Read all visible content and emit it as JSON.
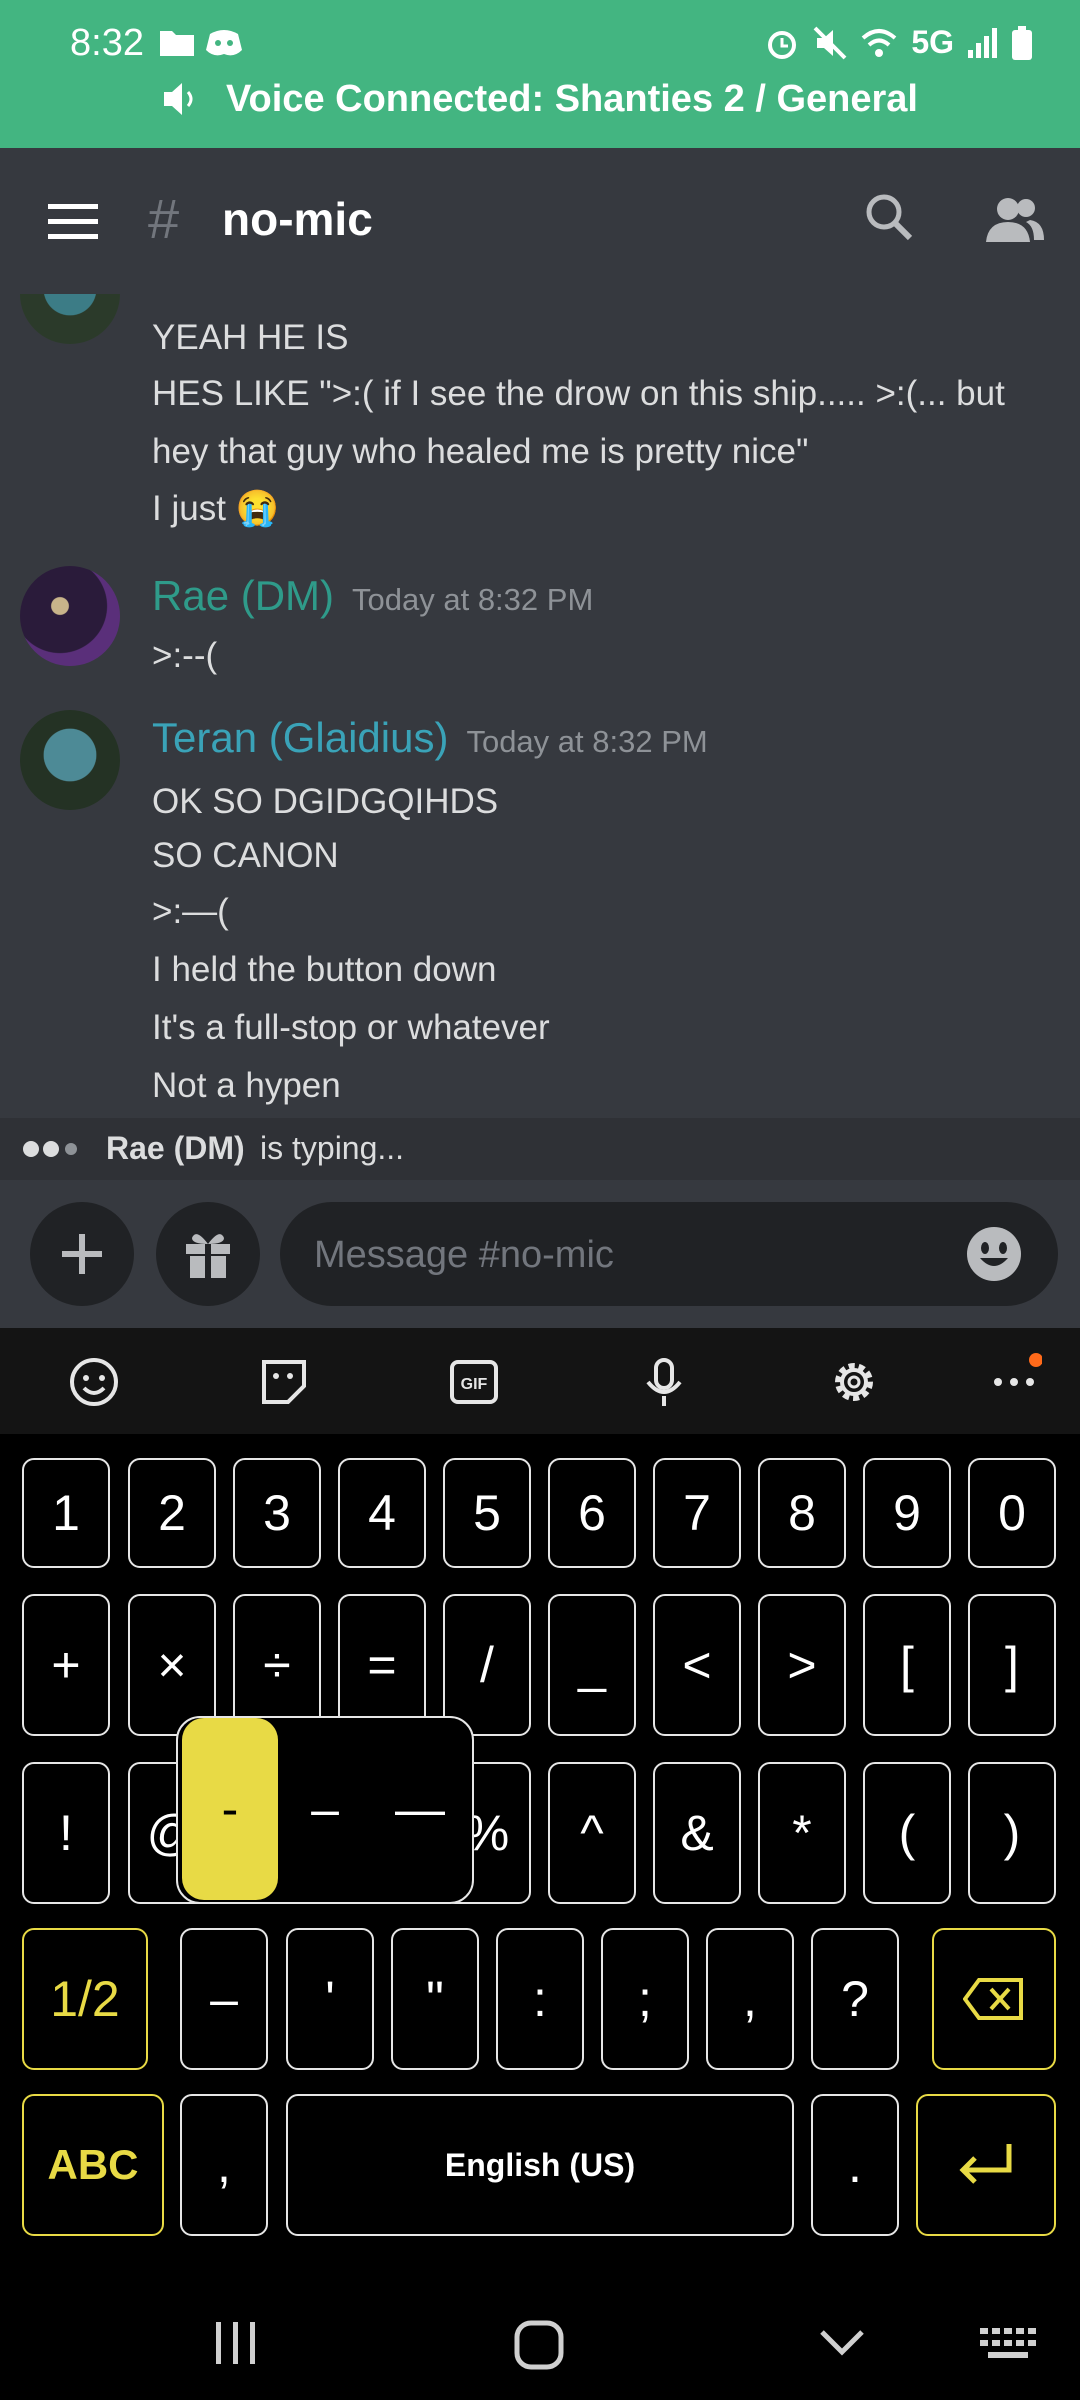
{
  "status_bar": {
    "time": "8:32",
    "network": "5G"
  },
  "voice_banner": {
    "text": "Voice Connected: Shanties 2 / General"
  },
  "header": {
    "hash": "#",
    "channel": "no-mic"
  },
  "messages": [
    {
      "lines": [
        "YEAH HE IS",
        "HES LIKE \">:( if I see the drow on this ship..... >:(... but",
        "hey that guy who healed me is pretty nice\"",
        "I just 😭"
      ]
    },
    {
      "author": "Rae (DM)",
      "timestamp": "Today at 8:32 PM",
      "author_color": "#2f9b8a",
      "lines": [
        ">:--("
      ]
    },
    {
      "author": "Teran (Glaidius)",
      "timestamp": "Today at 8:32 PM",
      "author_color": "#3aa3b8",
      "lines": [
        "OK SO DGIDGQIHDS",
        "SO CANON",
        ">:—(",
        "I held the button down",
        "It's a full-stop or whatever",
        "Not a hypen"
      ]
    }
  ],
  "typing": {
    "user": "Rae (DM)",
    "text": "is typing..."
  },
  "composer": {
    "placeholder": "Message #no-mic"
  },
  "keyboard": {
    "row1": [
      "1",
      "2",
      "3",
      "4",
      "5",
      "6",
      "7",
      "8",
      "9",
      "0"
    ],
    "row2": [
      "+",
      "×",
      "÷",
      "=",
      "/",
      "_",
      "<",
      ">",
      "[",
      "]"
    ],
    "row3": [
      "!",
      "@",
      "#",
      "$",
      "%",
      "^",
      "&",
      "*",
      "(",
      ")"
    ],
    "row4": [
      "1/2",
      "–",
      "'",
      "\"",
      ":",
      ";",
      ",",
      "?"
    ],
    "row5": {
      "abc": "ABC",
      "comma": ",",
      "space": "English (US)",
      "period": "."
    },
    "dash_popup": [
      "-",
      "–",
      "—"
    ],
    "accent_color": "#e8da45"
  }
}
